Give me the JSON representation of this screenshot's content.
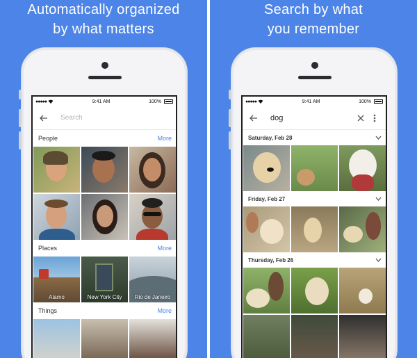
{
  "left": {
    "headline": [
      "Automatically organized",
      "by what matters"
    ],
    "status": {
      "time": "9:41 AM",
      "battery": "100%"
    },
    "search_placeholder": "Search",
    "sections": [
      {
        "title": "People",
        "more": "More"
      },
      {
        "title": "Places",
        "more": "More"
      },
      {
        "title": "Things",
        "more": "More"
      }
    ],
    "places": [
      "Alamo",
      "New York City",
      "Rio de Janeiro"
    ]
  },
  "right": {
    "headline": [
      "Search by what",
      "you remember"
    ],
    "status": {
      "time": "9:41 AM",
      "battery": "100%"
    },
    "query": "dog",
    "dates": [
      "Saturday, Feb 28",
      "Friday, Feb 27",
      "Thursday, Feb 26"
    ]
  },
  "icons": [
    "back-arrow-icon",
    "close-icon",
    "more-vert-icon",
    "chevron-down-icon",
    "wifi-icon",
    "battery-icon"
  ],
  "colors": {
    "background": "#4c84e8",
    "accent": "#4c84e8"
  }
}
